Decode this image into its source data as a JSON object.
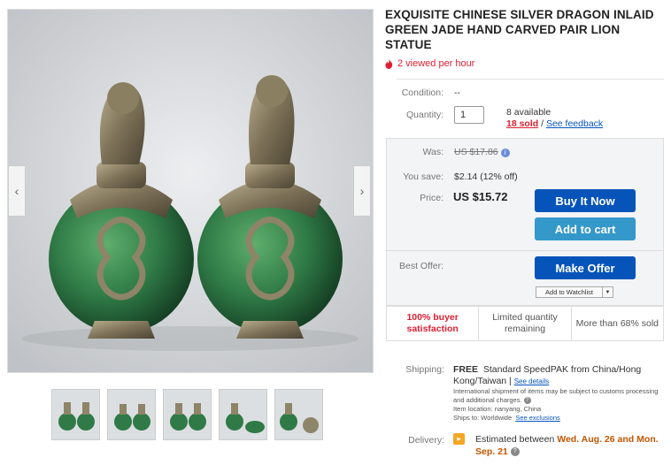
{
  "gallery": {
    "prev_icon": "chevron-left-icon",
    "next_icon": "chevron-right-icon",
    "prev_glyph": "‹",
    "next_glyph": "›",
    "thumbnail_count": 5
  },
  "listing": {
    "title": "EXQUISITE CHINESE SILVER DRAGON INLAID GREEN JADE HAND CARVED PAIR LION STATUE",
    "viewed": "2 viewed per hour",
    "condition_label": "Condition:",
    "condition_value": "--",
    "quantity_label": "Quantity:",
    "quantity_value": "1",
    "available": "8 available",
    "sold": "18 sold",
    "sold_sep": " / ",
    "feedback": "See feedback"
  },
  "pricing": {
    "was_label": "Was:",
    "was_value": "US $17.86",
    "save_label": "You save:",
    "save_value": "$2.14 (12% off)",
    "price_label": "Price:",
    "price_value": "US $15.72",
    "buy_now": "Buy It Now",
    "add_to_cart": "Add to cart",
    "best_offer_label": "Best Offer:",
    "make_offer": "Make Offer",
    "watchlist": "Add to Watchlist"
  },
  "signals": [
    "100% buyer satisfaction",
    "Limited quantity remaining",
    "More than 68% sold"
  ],
  "shipping": {
    "label": "Shipping:",
    "free": "FREE",
    "method": "Standard SpeedPAK from China/Hong Kong/Taiwan",
    "sep": " | ",
    "details": "See details",
    "note": "International shipment of items may be subject to customs processing and additional charges.",
    "location": "Item location:  nanyang, China",
    "ships_to": "Ships to:  Worldwide",
    "exclusions": "See exclusions"
  },
  "delivery": {
    "label": "Delivery:",
    "prefix": "Estimated between",
    "dates": "Wed. Aug. 26 and Mon. Sep. 21"
  },
  "colors": {
    "accent_blue": "#0654ba",
    "cart_blue": "#3498ca",
    "alert_red": "#dd1e31",
    "jade_green": "#2f7a46",
    "silver": "#8e8468"
  }
}
